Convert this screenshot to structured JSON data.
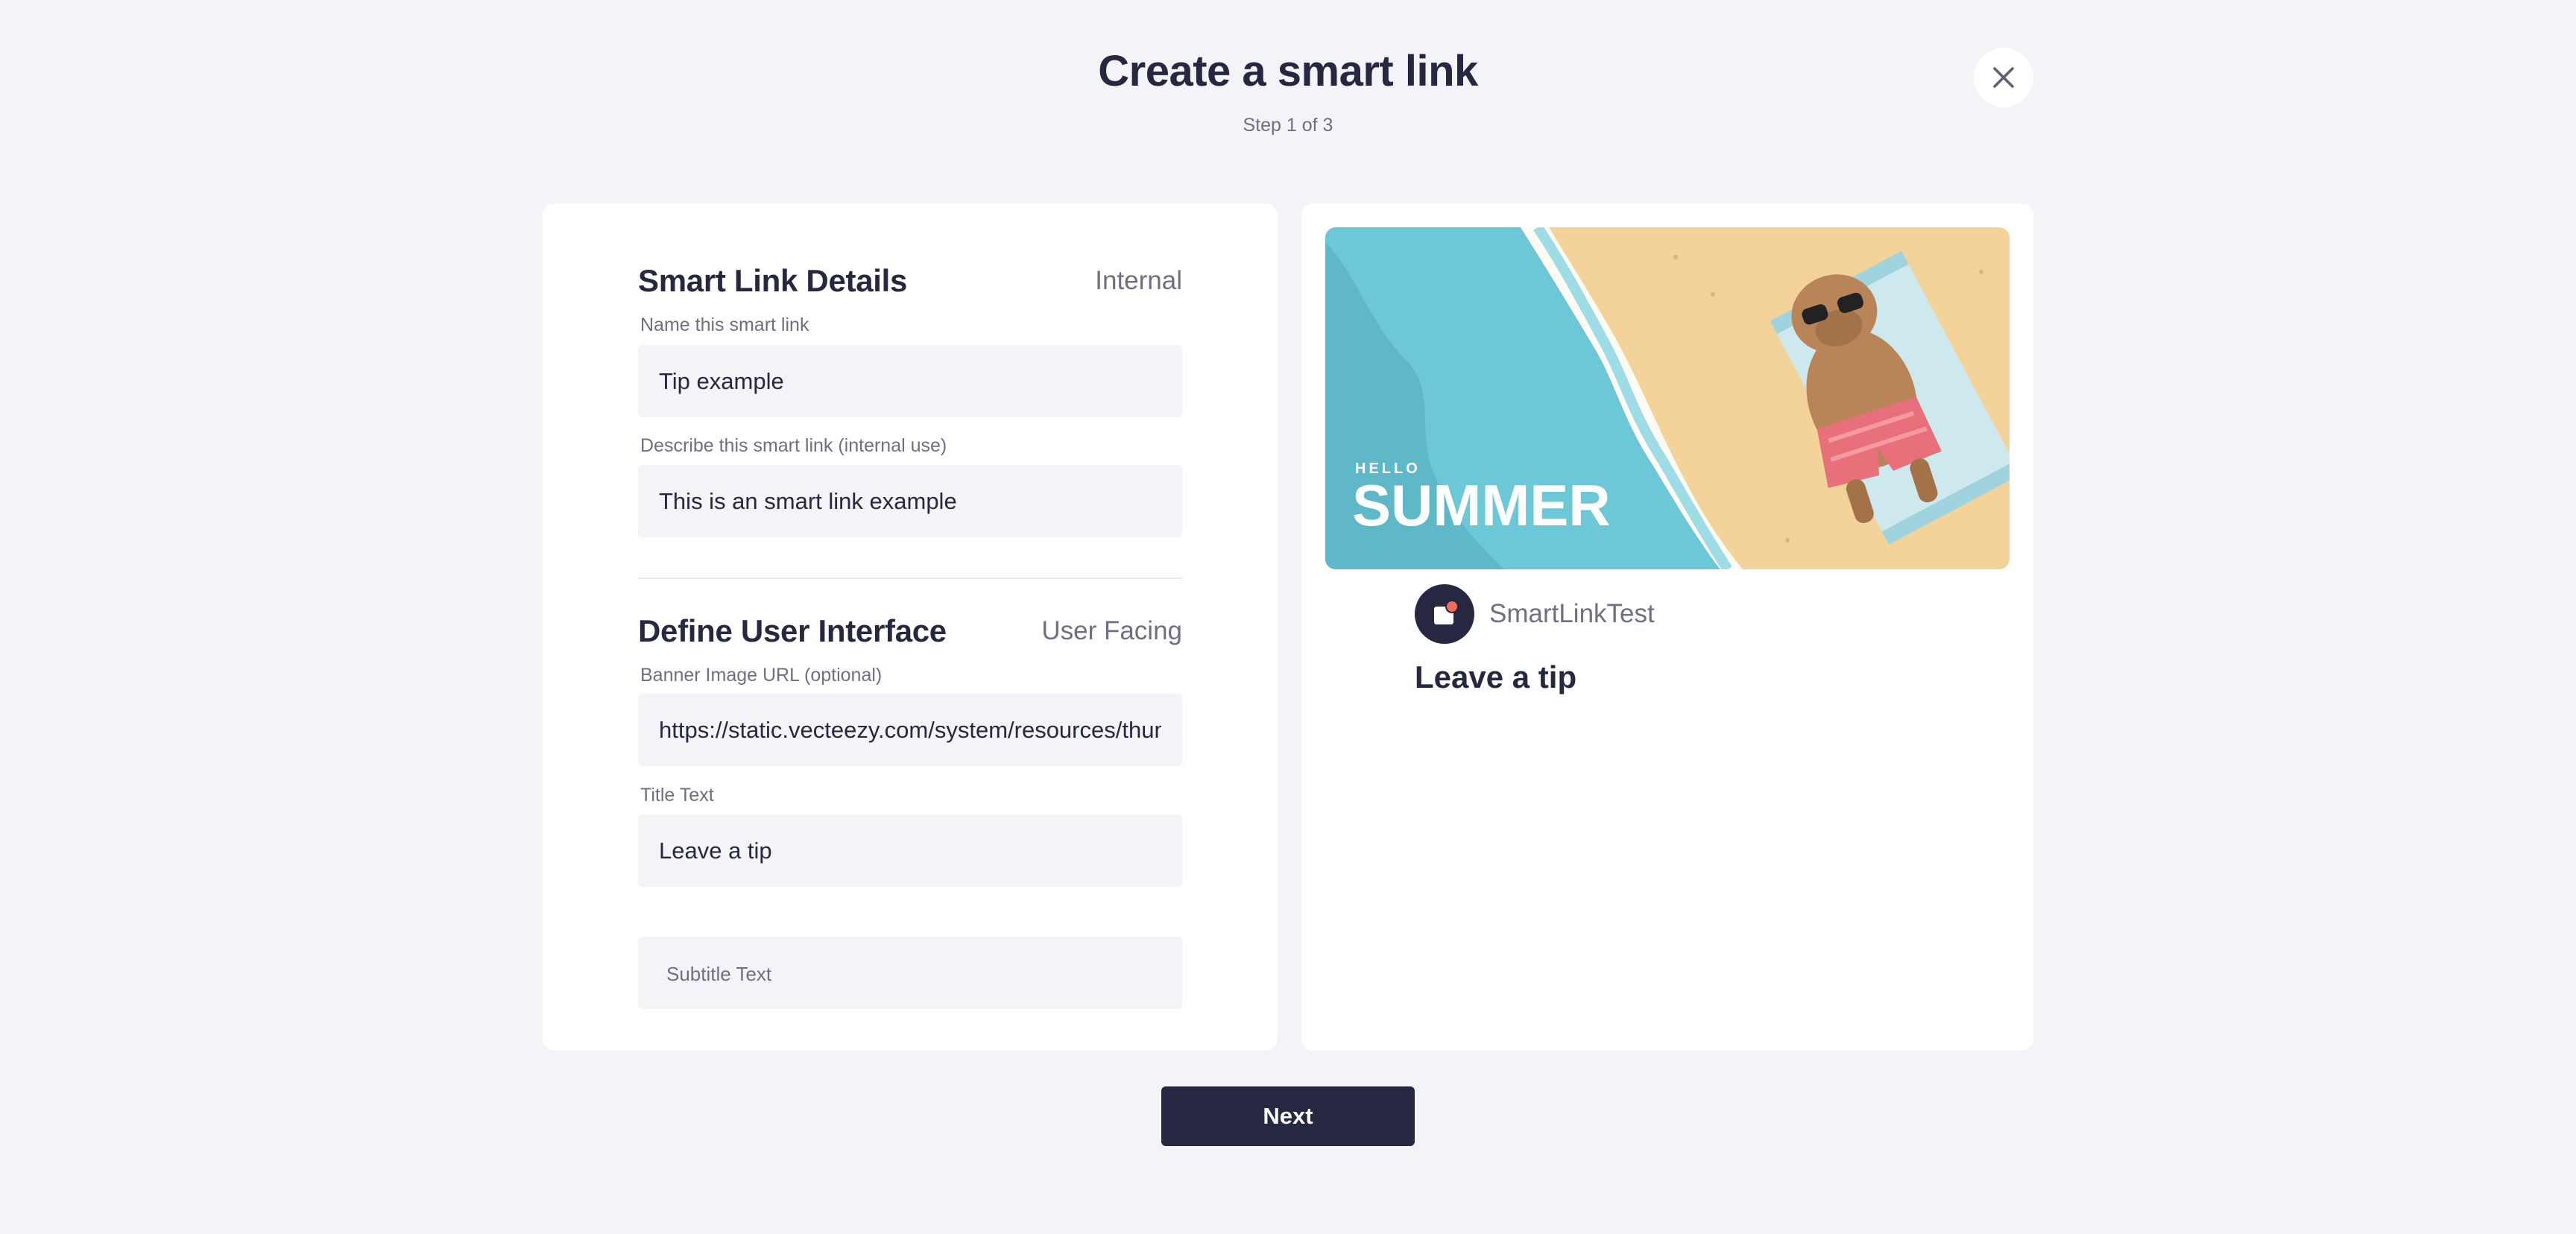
{
  "header": {
    "title": "Create a smart link",
    "step": "Step 1 of 3",
    "close_icon": "close-icon"
  },
  "form": {
    "details_section": {
      "title": "Smart Link Details",
      "tag": "Internal",
      "name_label": "Name this smart link",
      "name_value": "Tip example",
      "description_label": "Describe this smart link (internal use)",
      "description_value": "This is an smart link example"
    },
    "ui_section": {
      "title": "Define User Interface",
      "tag": "User Facing",
      "banner_label": "Banner Image URL (optional)",
      "banner_value": "https://static.vecteezy.com/system/resources/thumbnails/summer-capybara.jpg",
      "title_label": "Title Text",
      "title_value": "Leave a tip",
      "subtitle_placeholder": "Subtitle Text"
    }
  },
  "preview": {
    "banner": {
      "hello_text": "HELLO",
      "summer_text": "SUMMER"
    },
    "brand_name": "SmartLinkTest",
    "title": "Leave a tip"
  },
  "footer": {
    "next_label": "Next"
  },
  "colors": {
    "background": "#f3f3f8",
    "primary": "#252840",
    "muted_text": "#6d6f82",
    "sea": "#6cc8d6",
    "sand": "#f3d39a",
    "accent": "#f26b5b"
  }
}
